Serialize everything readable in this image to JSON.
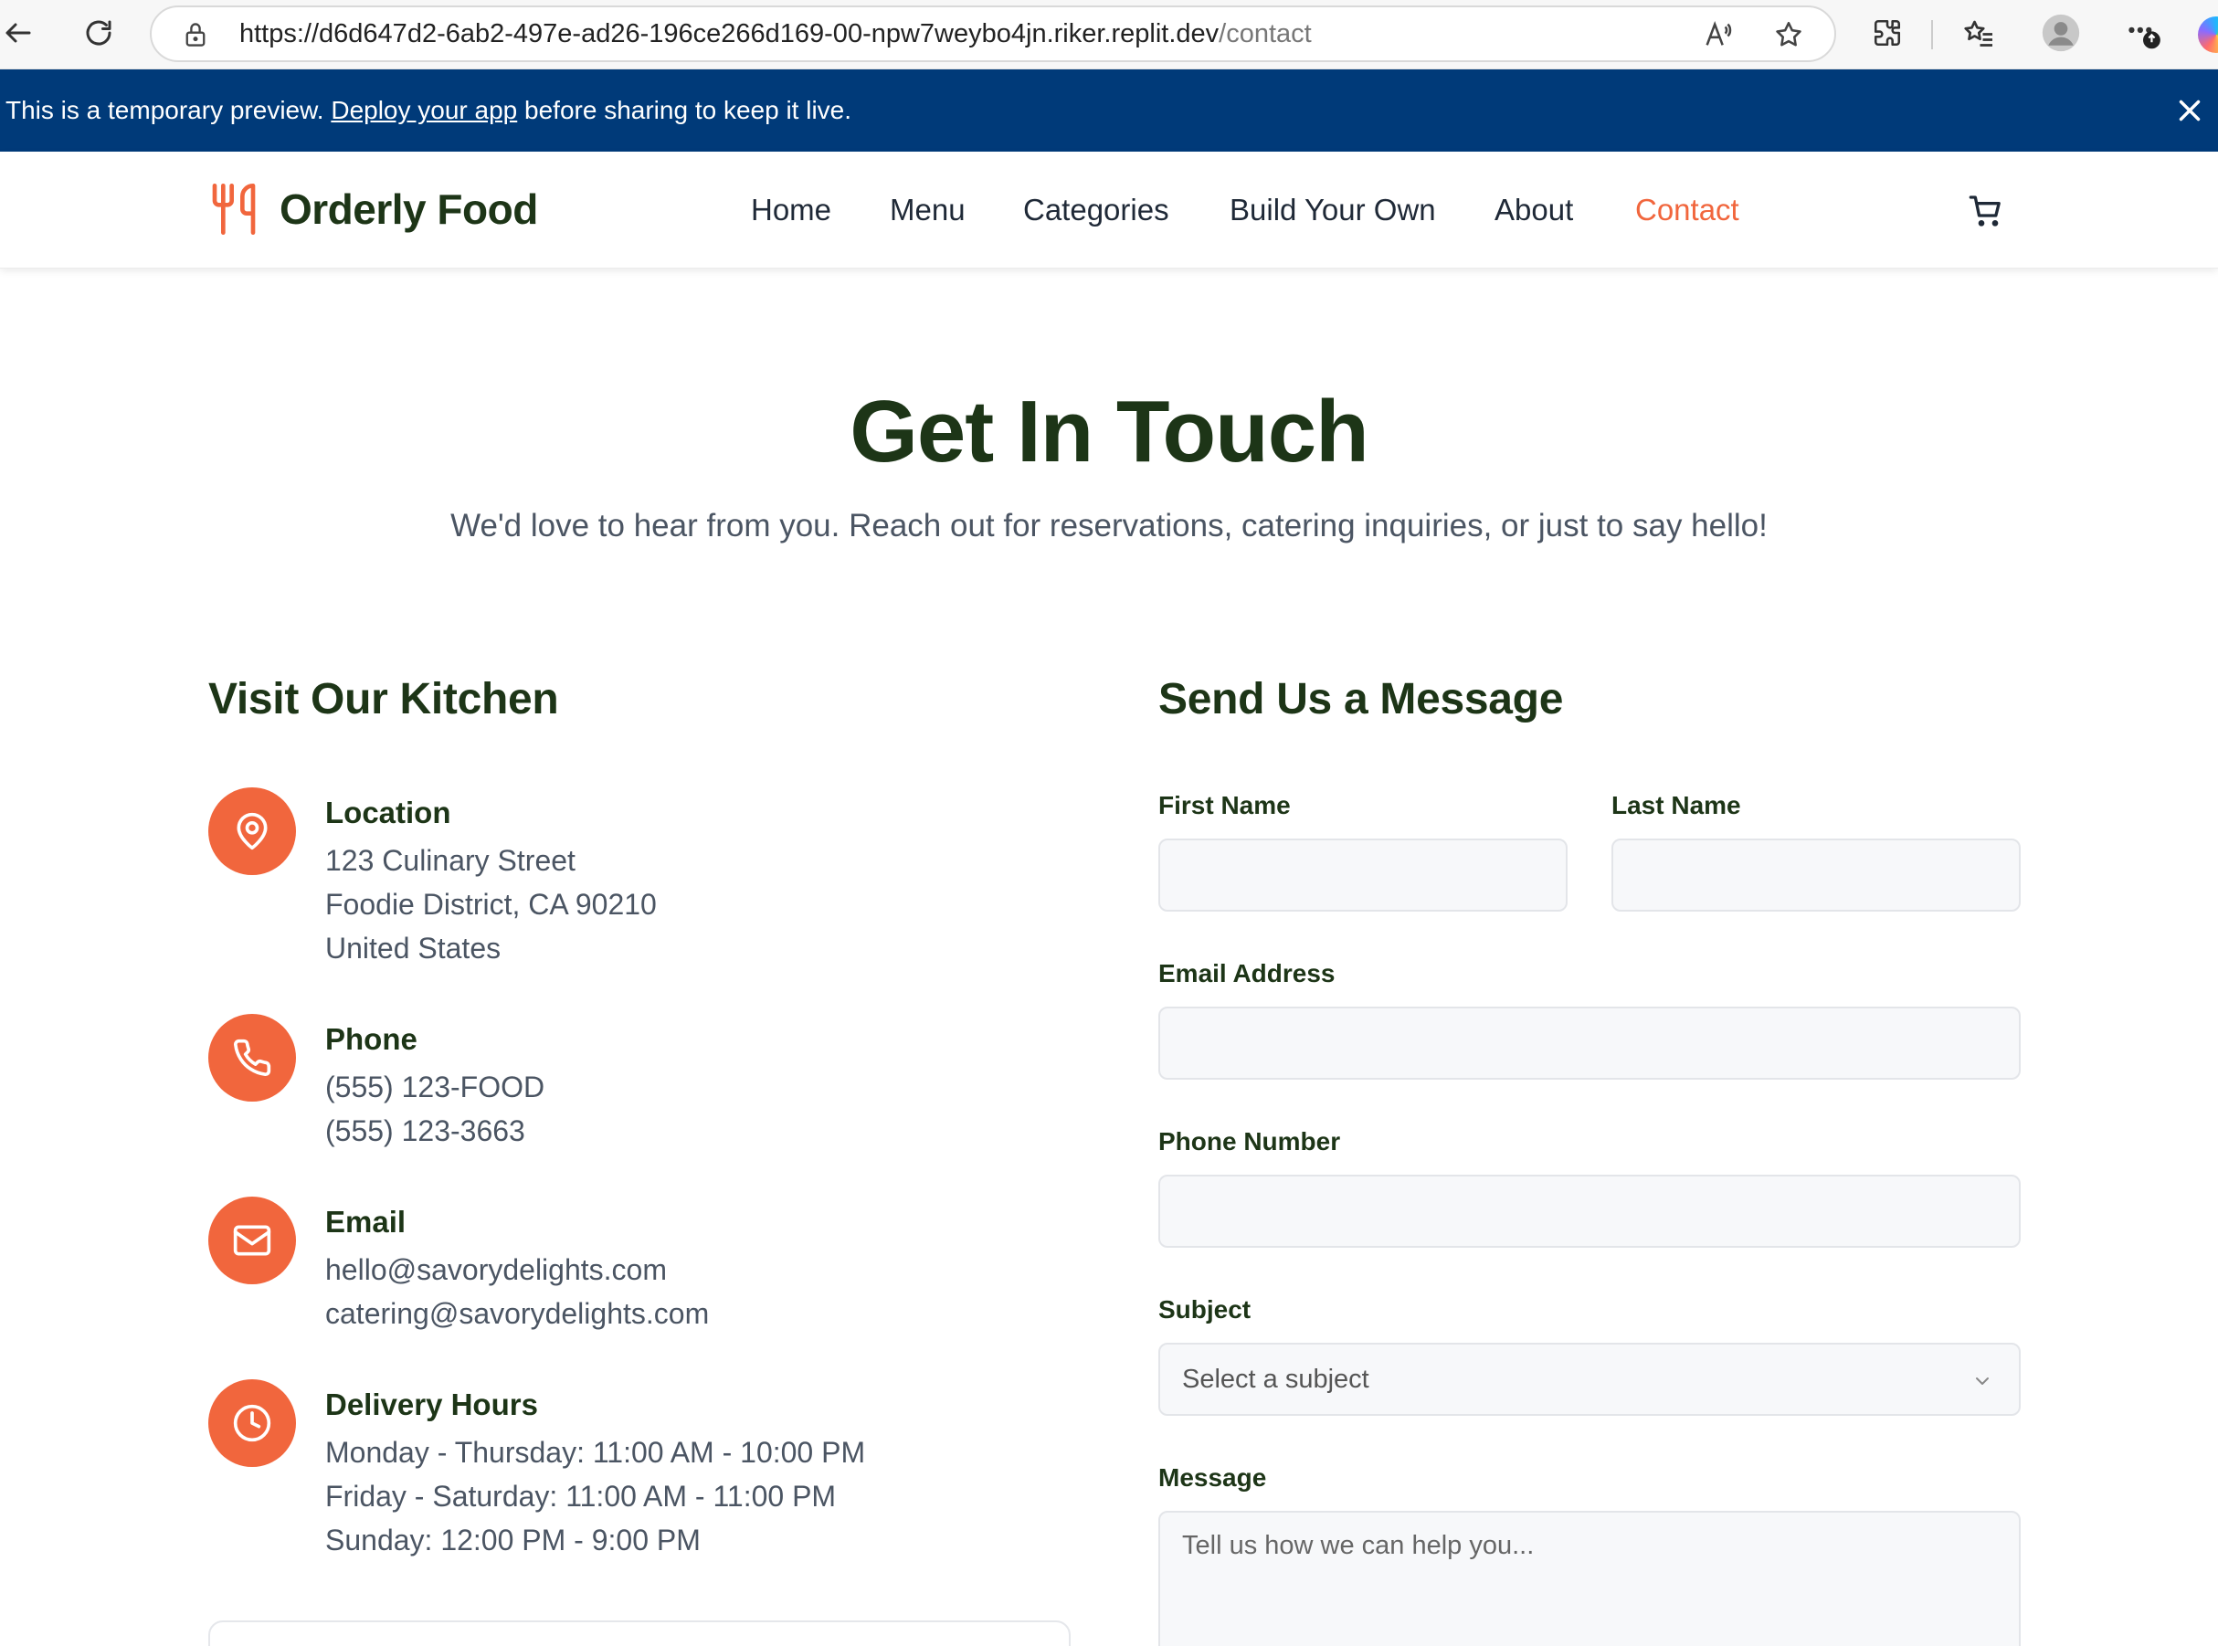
{
  "browser": {
    "url_host": "https://d6d647d2-6ab2-497e-ad26-196ce266d169-00-npw7weybo4jn.riker.replit.dev",
    "url_path": "/contact"
  },
  "banner": {
    "text_before": "This is a temporary preview. ",
    "link": "Deploy your app",
    "text_after": " before sharing to keep it live."
  },
  "header": {
    "brand": "Orderly Food",
    "nav": [
      "Home",
      "Menu",
      "Categories",
      "Build Your Own",
      "About",
      "Contact"
    ],
    "active": "Contact"
  },
  "hero": {
    "title": "Get In Touch",
    "subtitle": "We'd love to hear from you. Reach out for reservations, catering inquiries, or just to say hello!"
  },
  "visit": {
    "heading": "Visit Our Kitchen",
    "items": [
      {
        "icon": "map-pin-icon",
        "title": "Location",
        "lines": [
          "123 Culinary Street",
          "Foodie District, CA 90210",
          "United States"
        ]
      },
      {
        "icon": "phone-icon",
        "title": "Phone",
        "lines": [
          "(555) 123-FOOD",
          "(555) 123-3663"
        ]
      },
      {
        "icon": "mail-icon",
        "title": "Email",
        "lines": [
          "hello@savorydelights.com",
          "catering@savorydelights.com"
        ]
      },
      {
        "icon": "clock-icon",
        "title": "Delivery Hours",
        "lines": [
          "Monday - Thursday: 11:00 AM - 10:00 PM",
          "Friday - Saturday: 11:00 AM - 11:00 PM",
          "Sunday: 12:00 PM - 9:00 PM"
        ]
      }
    ]
  },
  "form": {
    "heading": "Send Us a Message",
    "first_name_label": "First Name",
    "last_name_label": "Last Name",
    "email_label": "Email Address",
    "phone_label": "Phone Number",
    "subject_label": "Subject",
    "subject_value": "Select a subject",
    "message_label": "Message",
    "message_placeholder": "Tell us how we can help you..."
  },
  "colors": {
    "accent": "#f1663d",
    "brand_dark": "#1d3517",
    "banner": "#003a79"
  }
}
